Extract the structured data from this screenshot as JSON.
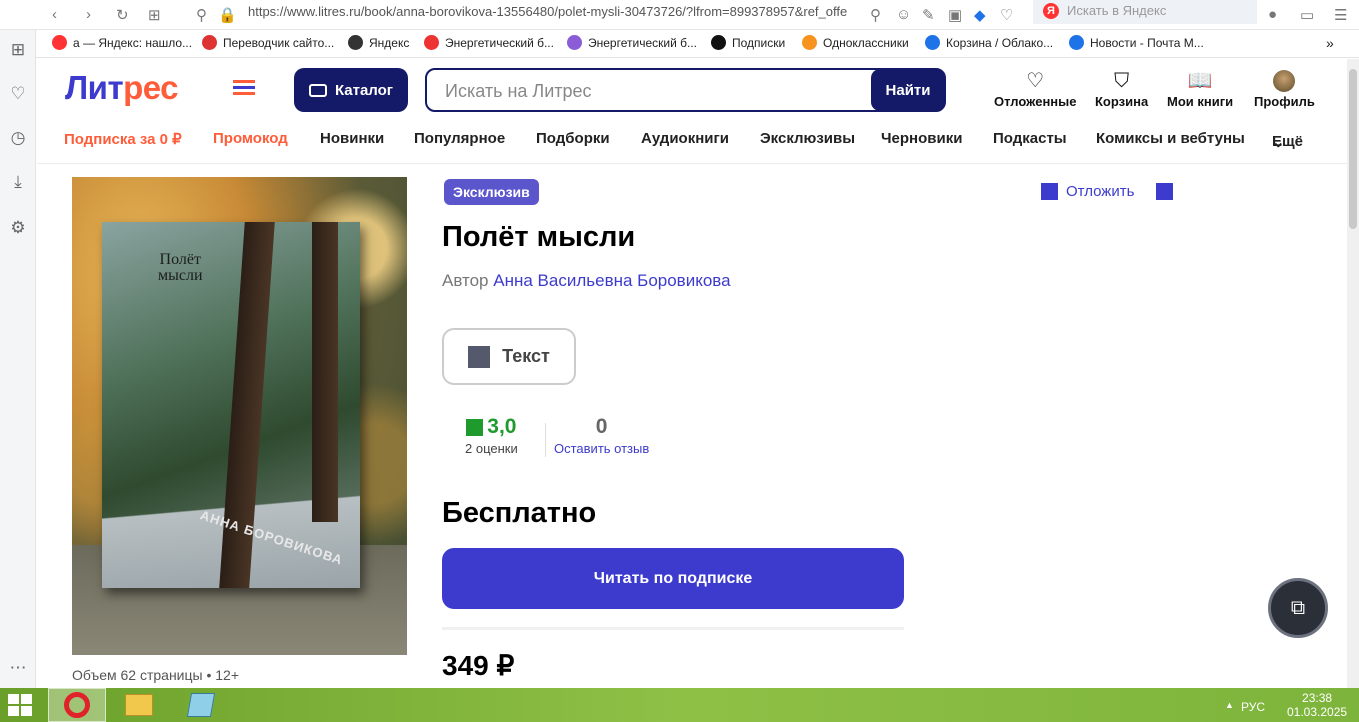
{
  "browser": {
    "url": "https://www.litres.ru/book/anna-borovikova-13556480/polet-mysli-30473726/?lfrom=899378957&ref_offe",
    "search_placeholder": "Искать в Яндекс",
    "bookmarks": [
      {
        "label": "а — Яндекс: нашло...",
        "color": "#f33"
      },
      {
        "label": "Переводчик сайто...",
        "color": "#d33"
      },
      {
        "label": "Яндекс",
        "color": "#333"
      },
      {
        "label": "Энергетический б...",
        "color": "#e33"
      },
      {
        "label": "Энергетический б...",
        "color": "#8a5cd6"
      },
      {
        "label": "Подписки",
        "color": "#111"
      },
      {
        "label": "Одноклассники",
        "color": "#f7931e"
      },
      {
        "label": "Корзина / Облако...",
        "color": "#1e73e8"
      },
      {
        "label": "Новости - Почта М...",
        "color": "#1e73e8"
      }
    ]
  },
  "header": {
    "logo_part1": "Лит",
    "logo_part2": "рес",
    "catalog_label": "Каталог",
    "search_placeholder": "Искать на Литрес",
    "search_button": "Найти",
    "actions": [
      {
        "label": "Отложенные",
        "icon": "heart-icon"
      },
      {
        "label": "Корзина",
        "icon": "cart-icon"
      },
      {
        "label": "Мои книги",
        "icon": "book-icon"
      },
      {
        "label": "Профиль",
        "icon": "avatar"
      }
    ]
  },
  "nav": {
    "items": [
      "Подписка за 0 ₽",
      "Промокод",
      "Новинки",
      "Популярное",
      "Подборки",
      "Аудиокниги",
      "Эксклюзивы",
      "Черновики",
      "Подкасты",
      "Комиксы и вебтуны",
      "Ещё"
    ]
  },
  "book": {
    "cover_title_line1": "Полёт",
    "cover_title_line2": "мысли",
    "cover_author": "АННА БОРОВИКОВА",
    "volume": "Объем 62 страницы",
    "age": "12+",
    "badge": "Эксклюзив",
    "defer": "Отложить",
    "title": "Полёт мысли",
    "author_prefix": "Автор",
    "author_name": "Анна Васильевна Боровикова",
    "type": "Текст",
    "rating": "3,0",
    "rating_count": "2 оценки",
    "reviews": "0",
    "reviews_link": "Оставить отзыв",
    "free_label": "Бесплатно",
    "read_button": "Читать по подписке",
    "price": "349 ₽"
  },
  "taskbar": {
    "lang": "РУС",
    "time": "23:38",
    "date": "01.03.2025"
  }
}
